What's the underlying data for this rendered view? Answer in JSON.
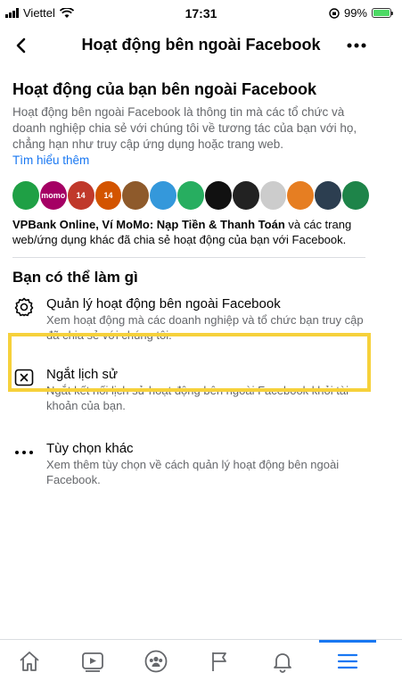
{
  "status": {
    "carrier": "Viettel",
    "time": "17:31",
    "battery": "99%"
  },
  "nav": {
    "title": "Hoạt động bên ngoài Facebook"
  },
  "section1": {
    "heading": "Hoạt động của bạn bên ngoài Facebook",
    "description": "Hoạt động bên ngoài Facebook là thông tin mà các tổ chức và doanh nghiệp chia sẻ với chúng tôi về tương tác của bạn với họ, chẳng hạn như truy cập ứng dụng hoặc trang web.",
    "learn_more": "Tìm hiểu thêm",
    "logos": [
      {
        "name": "vpbank-logo",
        "color": "#1fa045",
        "label": ""
      },
      {
        "name": "momo-logo",
        "color": "#a50064",
        "label": "momo"
      },
      {
        "name": "app14-logo-1",
        "color": "#c0392b",
        "label": "14"
      },
      {
        "name": "app14-logo-2",
        "color": "#d35400",
        "label": "14"
      },
      {
        "name": "game-logo",
        "color": "#8e5a2b",
        "label": ""
      },
      {
        "name": "bird-logo",
        "color": "#3498db",
        "label": ""
      },
      {
        "name": "leaf-logo",
        "color": "#27ae60",
        "label": ""
      },
      {
        "name": "camera-logo",
        "color": "#111111",
        "label": ""
      },
      {
        "name": "thien-ha-logo",
        "color": "#222222",
        "label": ""
      },
      {
        "name": "tinh-logo",
        "color": "#cccccc",
        "label": ""
      },
      {
        "name": "news-logo",
        "color": "#e67e22",
        "label": ""
      },
      {
        "name": "brand-logo",
        "color": "#2c3e50",
        "label": ""
      },
      {
        "name": "green-face-logo",
        "color": "#1e8449",
        "label": ""
      }
    ],
    "apps_text_bold": "VPBank Online, Ví MoMo: Nạp Tiền & Thanh Toán",
    "apps_text_rest": " và các trang web/ứng dụng khác đã chia sẻ hoạt động của bạn với Facebook."
  },
  "section2": {
    "heading": "Bạn có thể làm gì",
    "options": [
      {
        "title": "Quản lý hoạt động bên ngoài Facebook",
        "desc": "Xem hoạt động mà các doanh nghiệp và tổ chức bạn truy cập đã chia sẻ với chúng tôi."
      },
      {
        "title": "Ngắt lịch sử",
        "desc": "Ngắt kết nối lịch sử hoạt động bên ngoài Facebook khỏi tài khoản của bạn."
      },
      {
        "title": "Tùy chọn khác",
        "desc": "Xem thêm tùy chọn về cách quản lý hoạt động bên ngoài Facebook."
      }
    ]
  },
  "tabs": [
    "home-tab",
    "watch-tab",
    "groups-tab",
    "pages-tab",
    "notifications-tab",
    "menu-tab"
  ],
  "colors": {
    "accent": "#1877f2",
    "highlight": "#f6d13b"
  }
}
